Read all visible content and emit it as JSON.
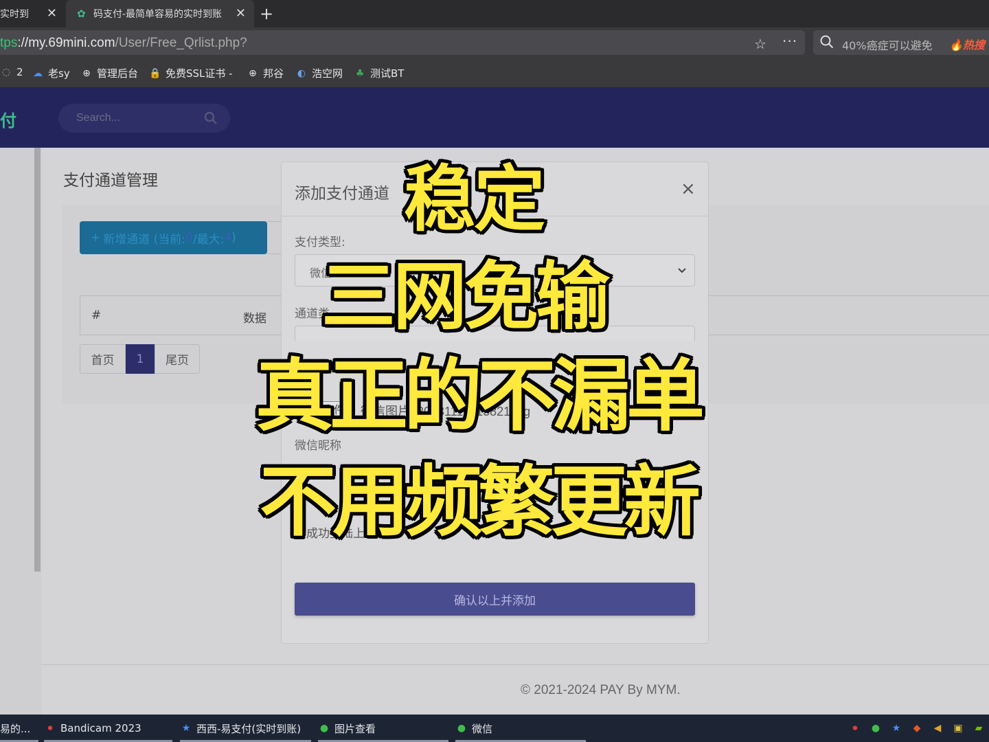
{
  "browser": {
    "tabs": [
      {
        "title": "码支付-实时到账",
        "visible_title": "实时到"
      },
      {
        "title": "码支付-最简单容易的实时到账",
        "visible_title": "码支付-最简单容易的实时到账"
      }
    ],
    "url": {
      "protocol": "tps",
      "host": "://my.69mini.com",
      "path": "/User/Free_Qrlist.php?"
    },
    "search": {
      "text": "40%癌症可以避免",
      "hot_label": "热搜"
    },
    "bookmarks": [
      {
        "label": "2",
        "icon": "chat-icon"
      },
      {
        "label": "老sy",
        "icon": "cloud-icon"
      },
      {
        "label": "管理后台",
        "icon": "globe-icon"
      },
      {
        "label": "免费SSL证书 -",
        "icon": "lock-icon"
      },
      {
        "label": "邦谷",
        "icon": "globe-icon"
      },
      {
        "label": "浩空网",
        "icon": "bird-icon"
      },
      {
        "label": "测试BT",
        "icon": "leaf-icon"
      }
    ]
  },
  "page": {
    "brand": "付",
    "search_placeholder": "Search...",
    "title": "支付通道管理",
    "add_button": {
      "prefix": "新增通道 (当前: ",
      "current": "0",
      "mid": "/最大: ",
      "max": "4",
      "suffix": ")"
    },
    "table_headers": [
      "#",
      "数据"
    ],
    "pager": {
      "first": "首页",
      "page": "1",
      "last": "尾页"
    },
    "footer": "© 2021-2024 PAY By MYM."
  },
  "modal": {
    "title": "添加支付通道",
    "close": "×",
    "pay_type_label": "支付类型:",
    "pay_type_value": "微信",
    "channel_label": "通道类",
    "file_button": "选择文件",
    "file_name": "微信图片_20231110113821.jpg",
    "nickname_label": "微信昵称",
    "hint": "法成功登陆上",
    "submit": "确认以上并添加"
  },
  "overlay": {
    "line1": "稳定",
    "line2": "三网免输",
    "line3": "真正的不漏单",
    "line4": "不用频繁更新",
    "color": "#ffe93d"
  },
  "taskbar": {
    "items": [
      {
        "label": "易的..."
      },
      {
        "label": "Bandicam 2023",
        "icon": "record-icon"
      },
      {
        "label": "西西-易支付(实时到账)",
        "icon": "star-icon"
      },
      {
        "label": "图片查看",
        "icon": "wechat-icon"
      },
      {
        "label": "微信",
        "icon": "wechat-icon"
      }
    ]
  }
}
